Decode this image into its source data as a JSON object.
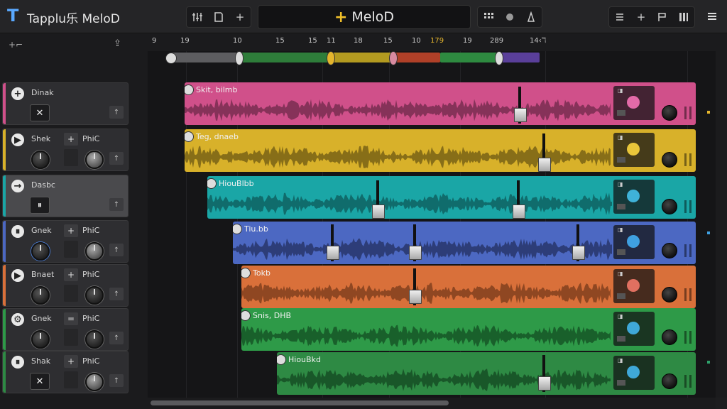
{
  "app": {
    "title": "Tapplu乐 MeloD",
    "project_name": "MeloD",
    "accent": "#f1c02a"
  },
  "toolbar": {
    "left_icons": [
      "mixer-icon",
      "save-icon",
      "add-icon"
    ],
    "center_icons": [
      "grid-icon",
      "loop-icon",
      "tempo-icon"
    ],
    "right_icons": [
      "list-icon",
      "add-icon",
      "flag-icon",
      "piano-icon",
      "menu-icon"
    ]
  },
  "ruler": {
    "labels": [
      "9",
      "19",
      "10",
      "15",
      "15",
      "11",
      "18",
      "15",
      "10",
      "179",
      "19",
      "289",
      "14‹ℸ"
    ]
  },
  "tracks": [
    {
      "name": "Dinak",
      "color": "#d0508a",
      "clip_name": "Skit, bilmb"
    },
    {
      "name": "Shek",
      "label2": "PhiC",
      "color": "#d8b12a",
      "clip_name": "Teg, dnaeb"
    },
    {
      "name": "Dasbc",
      "color": "#1aa6a6",
      "clip_name": "HiouBlbb",
      "selected": true
    },
    {
      "name": "Gnek",
      "label2": "PhiC",
      "color": "#4c68c2",
      "clip_name": "Tiu.bb"
    },
    {
      "name": "Bnaet",
      "label2": "PhiC",
      "color": "#d9703a",
      "clip_name": "Tokb"
    },
    {
      "name": "Gnek",
      "label2": "PhiC",
      "color": "#2e9a48",
      "clip_name": "Snis, DHB"
    },
    {
      "name": "Shak",
      "label2": "PhiC",
      "color": "#2e8a44",
      "clip_name": "HiouBkd"
    }
  ]
}
